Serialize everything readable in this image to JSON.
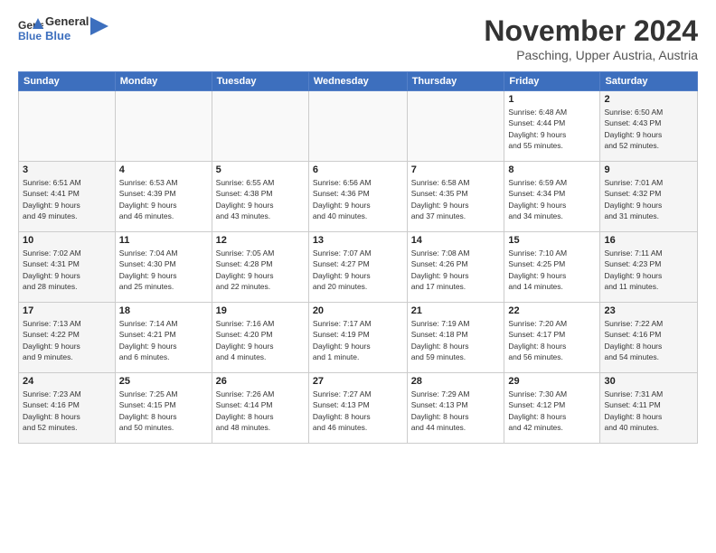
{
  "header": {
    "logo_line1": "General",
    "logo_line2": "Blue",
    "month": "November 2024",
    "location": "Pasching, Upper Austria, Austria"
  },
  "days_of_week": [
    "Sunday",
    "Monday",
    "Tuesday",
    "Wednesday",
    "Thursday",
    "Friday",
    "Saturday"
  ],
  "weeks": [
    [
      {
        "day": "",
        "info": ""
      },
      {
        "day": "",
        "info": ""
      },
      {
        "day": "",
        "info": ""
      },
      {
        "day": "",
        "info": ""
      },
      {
        "day": "",
        "info": ""
      },
      {
        "day": "1",
        "info": "Sunrise: 6:48 AM\nSunset: 4:44 PM\nDaylight: 9 hours\nand 55 minutes."
      },
      {
        "day": "2",
        "info": "Sunrise: 6:50 AM\nSunset: 4:43 PM\nDaylight: 9 hours\nand 52 minutes."
      }
    ],
    [
      {
        "day": "3",
        "info": "Sunrise: 6:51 AM\nSunset: 4:41 PM\nDaylight: 9 hours\nand 49 minutes."
      },
      {
        "day": "4",
        "info": "Sunrise: 6:53 AM\nSunset: 4:39 PM\nDaylight: 9 hours\nand 46 minutes."
      },
      {
        "day": "5",
        "info": "Sunrise: 6:55 AM\nSunset: 4:38 PM\nDaylight: 9 hours\nand 43 minutes."
      },
      {
        "day": "6",
        "info": "Sunrise: 6:56 AM\nSunset: 4:36 PM\nDaylight: 9 hours\nand 40 minutes."
      },
      {
        "day": "7",
        "info": "Sunrise: 6:58 AM\nSunset: 4:35 PM\nDaylight: 9 hours\nand 37 minutes."
      },
      {
        "day": "8",
        "info": "Sunrise: 6:59 AM\nSunset: 4:34 PM\nDaylight: 9 hours\nand 34 minutes."
      },
      {
        "day": "9",
        "info": "Sunrise: 7:01 AM\nSunset: 4:32 PM\nDaylight: 9 hours\nand 31 minutes."
      }
    ],
    [
      {
        "day": "10",
        "info": "Sunrise: 7:02 AM\nSunset: 4:31 PM\nDaylight: 9 hours\nand 28 minutes."
      },
      {
        "day": "11",
        "info": "Sunrise: 7:04 AM\nSunset: 4:30 PM\nDaylight: 9 hours\nand 25 minutes."
      },
      {
        "day": "12",
        "info": "Sunrise: 7:05 AM\nSunset: 4:28 PM\nDaylight: 9 hours\nand 22 minutes."
      },
      {
        "day": "13",
        "info": "Sunrise: 7:07 AM\nSunset: 4:27 PM\nDaylight: 9 hours\nand 20 minutes."
      },
      {
        "day": "14",
        "info": "Sunrise: 7:08 AM\nSunset: 4:26 PM\nDaylight: 9 hours\nand 17 minutes."
      },
      {
        "day": "15",
        "info": "Sunrise: 7:10 AM\nSunset: 4:25 PM\nDaylight: 9 hours\nand 14 minutes."
      },
      {
        "day": "16",
        "info": "Sunrise: 7:11 AM\nSunset: 4:23 PM\nDaylight: 9 hours\nand 11 minutes."
      }
    ],
    [
      {
        "day": "17",
        "info": "Sunrise: 7:13 AM\nSunset: 4:22 PM\nDaylight: 9 hours\nand 9 minutes."
      },
      {
        "day": "18",
        "info": "Sunrise: 7:14 AM\nSunset: 4:21 PM\nDaylight: 9 hours\nand 6 minutes."
      },
      {
        "day": "19",
        "info": "Sunrise: 7:16 AM\nSunset: 4:20 PM\nDaylight: 9 hours\nand 4 minutes."
      },
      {
        "day": "20",
        "info": "Sunrise: 7:17 AM\nSunset: 4:19 PM\nDaylight: 9 hours\nand 1 minute."
      },
      {
        "day": "21",
        "info": "Sunrise: 7:19 AM\nSunset: 4:18 PM\nDaylight: 8 hours\nand 59 minutes."
      },
      {
        "day": "22",
        "info": "Sunrise: 7:20 AM\nSunset: 4:17 PM\nDaylight: 8 hours\nand 56 minutes."
      },
      {
        "day": "23",
        "info": "Sunrise: 7:22 AM\nSunset: 4:16 PM\nDaylight: 8 hours\nand 54 minutes."
      }
    ],
    [
      {
        "day": "24",
        "info": "Sunrise: 7:23 AM\nSunset: 4:16 PM\nDaylight: 8 hours\nand 52 minutes."
      },
      {
        "day": "25",
        "info": "Sunrise: 7:25 AM\nSunset: 4:15 PM\nDaylight: 8 hours\nand 50 minutes."
      },
      {
        "day": "26",
        "info": "Sunrise: 7:26 AM\nSunset: 4:14 PM\nDaylight: 8 hours\nand 48 minutes."
      },
      {
        "day": "27",
        "info": "Sunrise: 7:27 AM\nSunset: 4:13 PM\nDaylight: 8 hours\nand 46 minutes."
      },
      {
        "day": "28",
        "info": "Sunrise: 7:29 AM\nSunset: 4:13 PM\nDaylight: 8 hours\nand 44 minutes."
      },
      {
        "day": "29",
        "info": "Sunrise: 7:30 AM\nSunset: 4:12 PM\nDaylight: 8 hours\nand 42 minutes."
      },
      {
        "day": "30",
        "info": "Sunrise: 7:31 AM\nSunset: 4:11 PM\nDaylight: 8 hours\nand 40 minutes."
      }
    ]
  ]
}
